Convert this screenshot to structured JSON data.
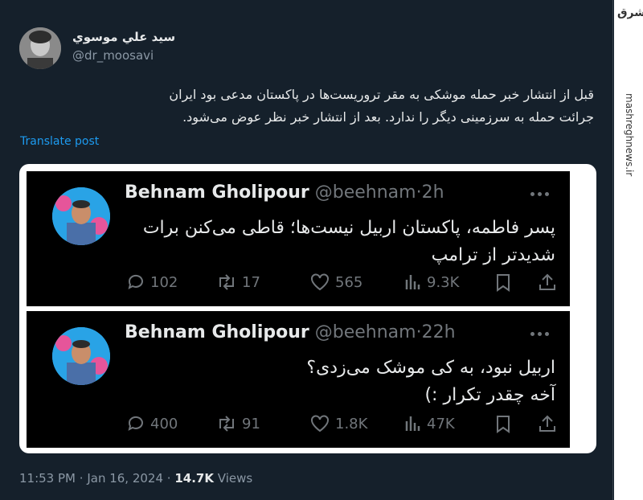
{
  "tweet": {
    "author_name": "سيد علي موسوي",
    "author_handle": "@dr_moosavi",
    "text_line1": "قبل از انتشار خبر حمله موشکی به مقر تروریست‌ها در پاکستان مدعی بود ایران",
    "text_line2": "جرائت حمله به سرزمینی دیگر را ندارد. بعد از انتشار خبر   نظر عوض می‌شود.",
    "translate_label": "Translate post",
    "time": "11:53 PM",
    "separator": "·",
    "date": "Jan 16, 2024",
    "views_count": "14.7K",
    "views_label": "Views"
  },
  "quoted": [
    {
      "name": "Behnam Gholipour",
      "handle": "@beehnam",
      "separator": "·",
      "age": "2h",
      "line1": "پسر فاطمه، پاکستان اربیل نیست‌ها؛ قاطی می‌کنن برات",
      "line2": "شدیدتر از ترامپ",
      "replies": "102",
      "reposts": "17",
      "likes": "565",
      "views": "9.3K"
    },
    {
      "name": "Behnam Gholipour",
      "handle": "@beehnam",
      "separator": "·",
      "age": "22h",
      "line1": "اربیل نبود، به کی موشک می‌زدی؟",
      "line2": "آخه چقدر تکرار :)",
      "replies": "400",
      "reposts": "91",
      "likes": "1.8K",
      "views": "47K"
    }
  ],
  "watermark": {
    "logo": "مشرق",
    "site": "mashreghnews.ir"
  },
  "colors": {
    "background": "#15202b",
    "quoted_background": "#000000",
    "link": "#1d9bf0",
    "muted": "#8b98a5"
  },
  "icons": [
    "more-icon",
    "reply-icon",
    "repost-icon",
    "like-icon",
    "views-icon",
    "bookmark-icon",
    "share-icon"
  ]
}
